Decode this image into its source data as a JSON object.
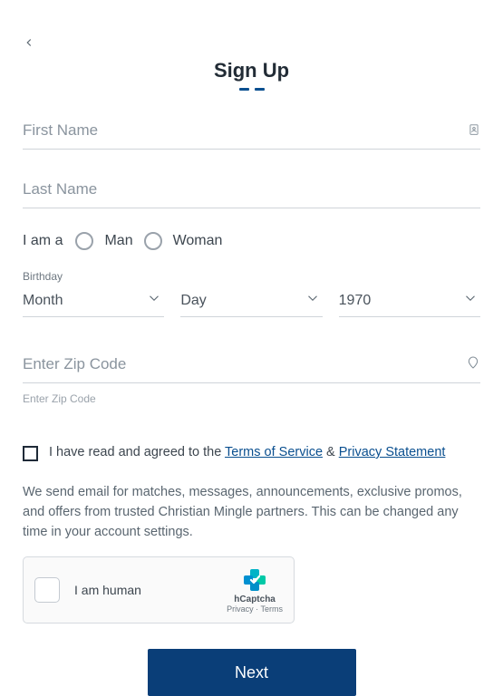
{
  "header": {
    "title": "Sign Up"
  },
  "fields": {
    "first_name": {
      "placeholder": "First Name",
      "value": ""
    },
    "last_name": {
      "placeholder": "Last Name",
      "value": ""
    },
    "zip": {
      "placeholder": "Enter Zip Code",
      "value": "",
      "helper": "Enter Zip Code"
    }
  },
  "gender": {
    "label": "I am a",
    "options": {
      "man": "Man",
      "woman": "Woman"
    }
  },
  "birthday": {
    "label": "Birthday",
    "month": "Month",
    "day": "Day",
    "year": "1970"
  },
  "terms": {
    "prefix": "I have read and agreed to the ",
    "tos": "Terms of Service",
    "amp": " & ",
    "privacy": "Privacy Statement"
  },
  "email_note": "We send email for matches, messages, announcements, exclusive promos, and offers from trusted Christian Mingle partners. This can be changed any time in your account settings.",
  "captcha": {
    "label": "I am human",
    "brand": "hCaptcha",
    "links": "Privacy · Terms"
  },
  "actions": {
    "next": "Next"
  }
}
